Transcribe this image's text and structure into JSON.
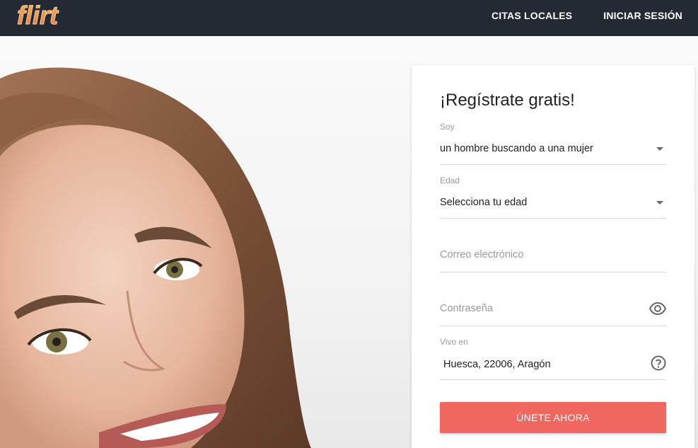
{
  "brand": {
    "logo_text": "flirt",
    "logo_color": "#f48a2e"
  },
  "nav": {
    "local_dates": "CITAS LOCALES",
    "login": "INICIAR SESIÓN"
  },
  "signup": {
    "title": "¡Regístrate gratis!",
    "i_am": {
      "label": "Soy",
      "value": "un hombre buscando a una mujer"
    },
    "age": {
      "label": "Edad",
      "value": "Selecciona tu edad"
    },
    "email": {
      "placeholder": "Correo electrónico"
    },
    "password": {
      "placeholder": "Contraseña"
    },
    "location": {
      "label": "Vivo en",
      "value": "Huesca, 22006, Aragón"
    },
    "submit": "ÚNETE AHORA"
  },
  "colors": {
    "topbar": "#232a34",
    "accent": "#f0675f"
  },
  "icons": {
    "age_caret": "caret-down-icon",
    "i_am_caret": "caret-down-icon",
    "password": "eye-icon",
    "location_help": "help-circle-icon"
  }
}
